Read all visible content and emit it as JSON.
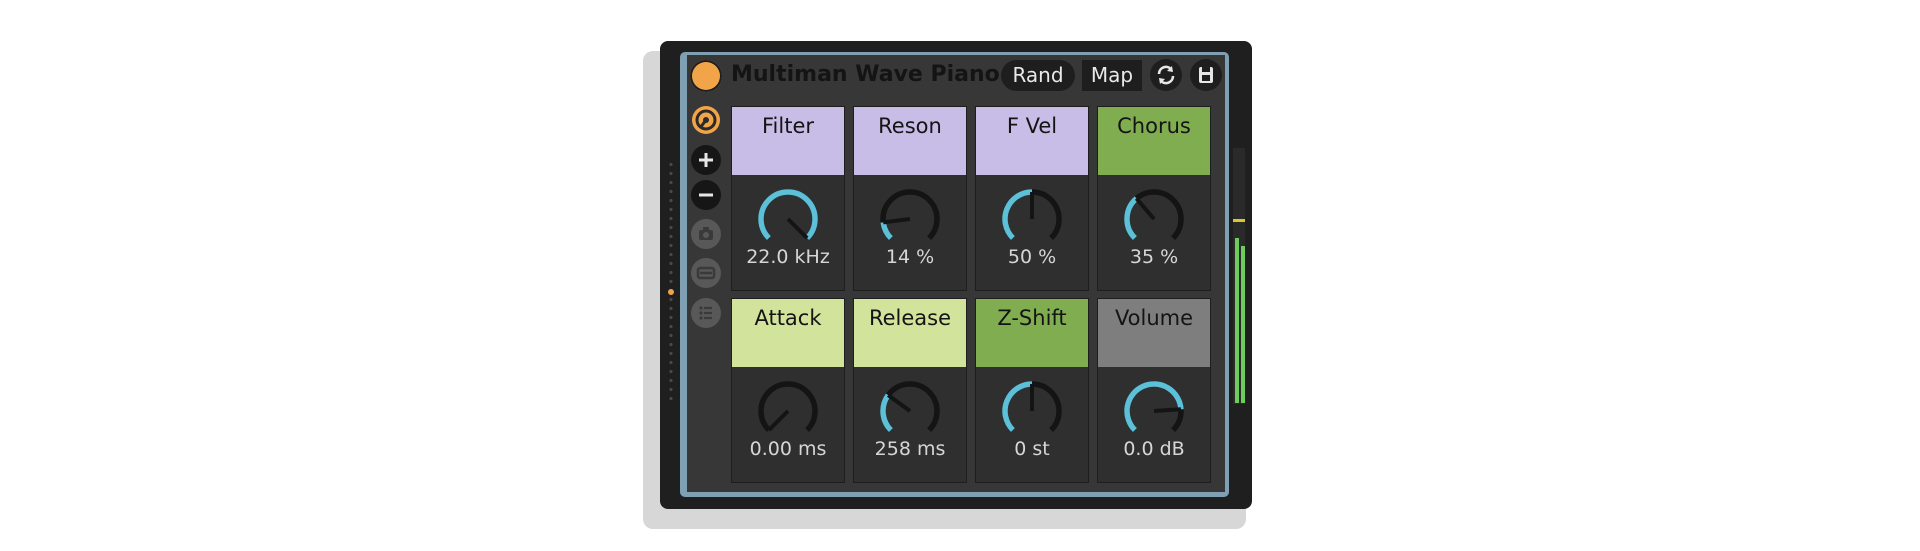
{
  "device": {
    "title": "Multiman Wave Piano",
    "rand_label": "Rand",
    "map_label": "Map"
  },
  "colors": {
    "power": "#f2a548",
    "lavender": "#c8bde6",
    "light_green": "#d2e39b",
    "green": "#80ad50",
    "gray": "#7e7e7e",
    "knob_arc": "#5bc0d8",
    "meter": "#6dcd5a"
  },
  "icons": {
    "power": "power-icon",
    "hot_swap": "hot-swap-icon",
    "add": "plus-icon",
    "remove": "minus-icon",
    "snapshot": "camera-icon",
    "variations": "variations-icon",
    "list": "list-icon",
    "refresh": "refresh-icon",
    "save": "save-icon"
  },
  "macros": [
    {
      "name": "Filter",
      "value": "22.0 kHz",
      "level": 1.0,
      "color": "#c8bde6"
    },
    {
      "name": "Reson",
      "value": "14 %",
      "level": 0.14,
      "color": "#c8bde6"
    },
    {
      "name": "F Vel",
      "value": "50 %",
      "level": 0.5,
      "color": "#c8bde6"
    },
    {
      "name": "Chorus",
      "value": "35 %",
      "level": 0.35,
      "color": "#80ad50"
    },
    {
      "name": "Attack",
      "value": "0.00 ms",
      "level": 0.0,
      "color": "#d2e39b"
    },
    {
      "name": "Release",
      "value": "258 ms",
      "level": 0.3,
      "color": "#d2e39b"
    },
    {
      "name": "Z-Shift",
      "value": "0 st",
      "level": 0.5,
      "color": "#80ad50"
    },
    {
      "name": "Volume",
      "value": "0.0 dB",
      "level": 0.82,
      "color": "#7e7e7e"
    }
  ]
}
